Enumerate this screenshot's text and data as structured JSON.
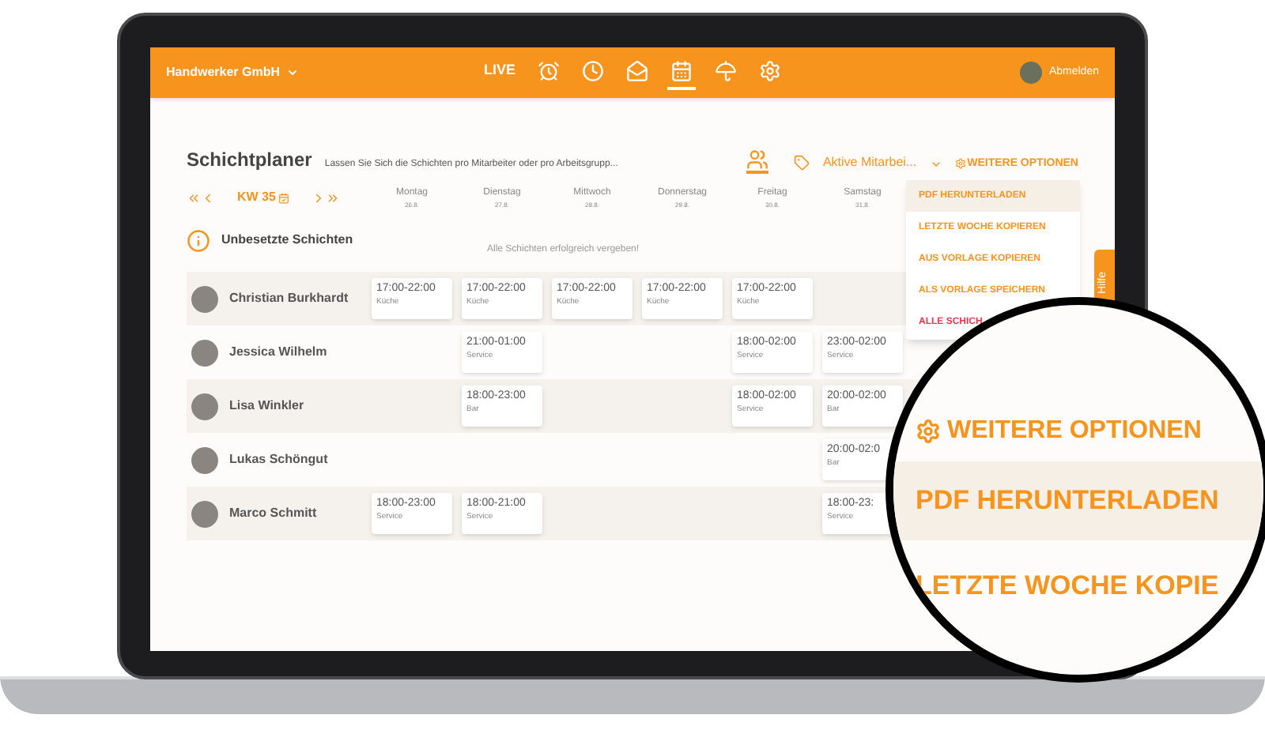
{
  "app_bar": {
    "company": "Handwerker GmbH",
    "nav": [
      {
        "kind": "text",
        "label": "LIVE",
        "selected": false
      },
      {
        "kind": "icon",
        "selected": false
      },
      {
        "kind": "icon",
        "selected": false
      },
      {
        "kind": "icon",
        "selected": false
      },
      {
        "kind": "icon",
        "selected": true
      },
      {
        "kind": "icon",
        "selected": false
      },
      {
        "kind": "icon",
        "selected": false
      }
    ],
    "logout": "Abmelden"
  },
  "planner": {
    "title": "Schichtplaner",
    "subtitle": "Lassen Sie Sich die Schichten pro Mitarbeiter oder pro Arbeitsgrupp...",
    "filter": "Aktive Mitarbei...",
    "more_options": "WEITERE OPTIONEN",
    "week": "KW 35",
    "days": [
      {
        "name": "Montag",
        "date": "26.8."
      },
      {
        "name": "Dienstag",
        "date": "27.8."
      },
      {
        "name": "Mittwoch",
        "date": "28.8."
      },
      {
        "name": "Donnerstag",
        "date": "29.8."
      },
      {
        "name": "Freitag",
        "date": "30.8."
      },
      {
        "name": "Samstag",
        "date": "31.8."
      }
    ],
    "unassigned": {
      "title": "Unbesetzte Schichten",
      "message": "Alle Schichten erfolgreich vergeben!"
    },
    "employees": [
      {
        "name": "Christian Burkhardt",
        "shifts": [
          {
            "kind": "shift",
            "time": "17:00-22:00",
            "area": "Küche"
          },
          {
            "kind": "shift",
            "time": "17:00-22:00",
            "area": "Küche"
          },
          {
            "kind": "shift",
            "time": "17:00-22:00",
            "area": "Küche"
          },
          {
            "kind": "shift",
            "time": "17:00-22:00",
            "area": "Küche"
          },
          {
            "kind": "shift",
            "time": "17:00-22:00",
            "area": "Küche"
          },
          {
            "kind": "empty"
          }
        ]
      },
      {
        "name": "Jessica Wilhelm",
        "shifts": [
          {
            "kind": "empty"
          },
          {
            "kind": "shift",
            "time": "21:00-01:00",
            "area": "Service"
          },
          {
            "kind": "empty"
          },
          {
            "kind": "empty"
          },
          {
            "kind": "shift",
            "time": "18:00-02:00",
            "area": "Service"
          },
          {
            "kind": "shift",
            "time": "23:00-02:00",
            "area": "Service"
          }
        ]
      },
      {
        "name": "Lisa Winkler",
        "shifts": [
          {
            "kind": "empty"
          },
          {
            "kind": "shift",
            "time": "18:00-23:00",
            "area": "Bar"
          },
          {
            "kind": "empty"
          },
          {
            "kind": "empty"
          },
          {
            "kind": "shift",
            "time": "18:00-02:00",
            "area": "Service"
          },
          {
            "kind": "shift",
            "time": "20:00-02:00",
            "area": "Bar"
          }
        ]
      },
      {
        "name": "Lukas Schöngut",
        "shifts": [
          {
            "kind": "empty"
          },
          {
            "kind": "empty"
          },
          {
            "kind": "empty"
          },
          {
            "kind": "empty"
          },
          {
            "kind": "empty"
          },
          {
            "kind": "shift",
            "time": "20:00-02:0",
            "area": "Bar"
          }
        ]
      },
      {
        "name": "Marco Schmitt",
        "shifts": [
          {
            "kind": "shift",
            "time": "18:00-23:00",
            "area": "Service"
          },
          {
            "kind": "shift",
            "time": "18:00-21:00",
            "area": "Service"
          },
          {
            "kind": "empty"
          },
          {
            "kind": "empty"
          },
          {
            "kind": "empty"
          },
          {
            "kind": "shift",
            "time": "18:00-23:",
            "area": "Service"
          }
        ]
      }
    ]
  },
  "menu": [
    {
      "label": "PDF HERUNTERLADEN",
      "selected": true,
      "kind": "normal"
    },
    {
      "label": "LETZTE WOCHE KOPIEREN",
      "selected": false,
      "kind": "normal"
    },
    {
      "label": "AUS VORLAGE KOPIEREN",
      "selected": false,
      "kind": "normal"
    },
    {
      "label": "ALS VORLAGE SPEICHERN",
      "selected": false,
      "kind": "normal"
    },
    {
      "label": "ALLE SCHICH",
      "selected": false,
      "kind": "danger"
    }
  ],
  "help_tab": "Hilfe",
  "magnifier": {
    "title": "WEITERE OPTIONEN",
    "items": [
      {
        "label": "PDF HERUNTERLADEN",
        "selected": true
      },
      {
        "label": "LETZTE WOCHE KOPIE",
        "selected": false
      }
    ]
  }
}
